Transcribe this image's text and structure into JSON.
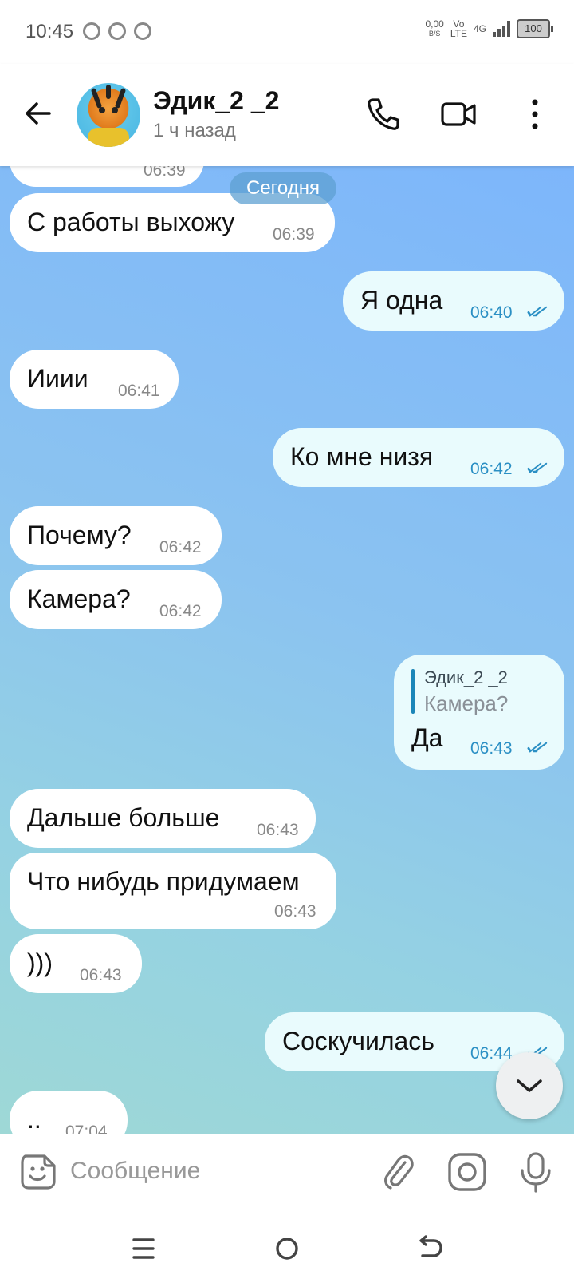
{
  "status_bar": {
    "time": "10:45",
    "speed_value": "0,00",
    "speed_unit": "B/S",
    "volte_top": "Vo",
    "volte_bottom": "LTE",
    "network": "4G",
    "battery": "100"
  },
  "header": {
    "contact_name": "Эдик_2 _2",
    "last_seen": "1 ч назад",
    "icons": [
      "back-arrow-icon",
      "phone-icon",
      "video-camera-icon",
      "more-vertical-icon"
    ]
  },
  "chat": {
    "date_separator": "Сегодня",
    "partial_top_time": "06:39",
    "messages": [
      {
        "dir": "in",
        "text": "С работы выхожу",
        "time": "06:39"
      },
      {
        "dir": "out",
        "text": "Я одна",
        "time": "06:40",
        "read": true
      },
      {
        "dir": "in",
        "text": "Ииии",
        "time": "06:41"
      },
      {
        "dir": "out",
        "text": "Ко мне низя",
        "time": "06:42",
        "read": true
      },
      {
        "dir": "in",
        "text": "Почему?",
        "time": "06:42"
      },
      {
        "dir": "in",
        "text": "Камера?",
        "time": "06:42"
      },
      {
        "dir": "out",
        "text": "Да",
        "time": "06:43",
        "read": true,
        "reply_to": {
          "name": "Эдик_2 _2",
          "text": "Камера?"
        }
      },
      {
        "dir": "in",
        "text": "Дальше больше",
        "time": "06:43"
      },
      {
        "dir": "in",
        "text": "Что нибудь придумаем",
        "time": "06:43"
      },
      {
        "dir": "in",
        "text": ")))",
        "time": "06:43"
      },
      {
        "dir": "out",
        "text": "Соскучилась",
        "time": "06:44",
        "read": true
      },
      {
        "dir": "in",
        "text": "..",
        "time": "07:04"
      }
    ]
  },
  "input": {
    "placeholder": "Сообщение",
    "icons": [
      "sticker-icon",
      "attach-icon",
      "camera-icon",
      "microphone-icon"
    ]
  },
  "colors": {
    "accent": "#2a8fc4",
    "outgoing_bubble": "#e9fbfd",
    "incoming_bubble": "#ffffff"
  }
}
